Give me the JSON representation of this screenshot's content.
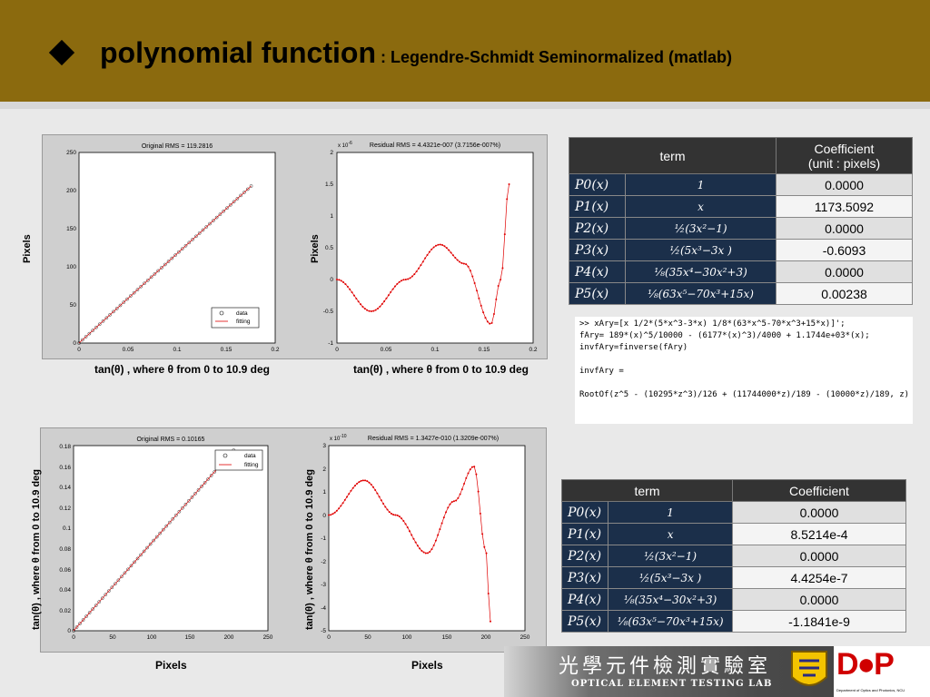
{
  "header": {
    "title_main": "polynomial function",
    "title_sub": " : Legendre-Schmidt Seminormalized (matlab)",
    "bg_color": "#8b6a0e"
  },
  "plots": {
    "p1": {
      "title": "Original RMS = 119.2816",
      "yticks": [
        "250",
        "200",
        "150",
        "100",
        "50",
        "0"
      ],
      "xticks": [
        "0",
        "0.05",
        "0.1",
        "0.15",
        "0.2"
      ],
      "legend": [
        "data",
        "fitting"
      ],
      "ylabel": "Pixels",
      "caption": "tan(θ) , where θ from 0 to 10.9 deg"
    },
    "p2": {
      "title": "Residual RMS = 4.4321e-007 (3.7156e-007%)",
      "exponent": "x 10",
      "exponent_pow": "-6",
      "yticks": [
        "2",
        "1.5",
        "1",
        "0.5",
        "0",
        "-0.5",
        "-1"
      ],
      "xticks": [
        "0",
        "0.05",
        "0.1",
        "0.15",
        "0.2"
      ],
      "ylabel": "Pixels",
      "caption": "tan(θ) , where θ from 0 to 10.9 deg"
    },
    "p3": {
      "title": "Original RMS = 0.10165",
      "yticks": [
        "0.18",
        "0.16",
        "0.14",
        "0.12",
        "0.1",
        "0.08",
        "0.06",
        "0.04",
        "0.02",
        "0"
      ],
      "xticks": [
        "0",
        "50",
        "100",
        "150",
        "200",
        "250"
      ],
      "legend": [
        "data",
        "fitting"
      ],
      "ylabel": "tan(θ) , where θ from 0 to 10.9 deg",
      "caption": "Pixels"
    },
    "p4": {
      "title": "Residual RMS = 1.3427e-010 (1.3209e-007%)",
      "exponent": "x 10",
      "exponent_pow": "-10",
      "yticks": [
        "3",
        "2",
        "1",
        "0",
        "-1",
        "-2",
        "-3",
        "-4",
        "-5"
      ],
      "xticks": [
        "0",
        "50",
        "100",
        "150",
        "200",
        "250"
      ],
      "ylabel": "tan(θ) , where θ from 0 to 10.9 deg",
      "caption": "Pixels"
    }
  },
  "table1": {
    "header_term": "term",
    "header_coef_line1": "Coefficient",
    "header_coef_line2": "(unit : pixels)",
    "rows": [
      {
        "term": "P0(x)",
        "expr": "1",
        "value": "0.0000"
      },
      {
        "term": "P1(x)",
        "expr": "x",
        "value": "1173.5092"
      },
      {
        "term": "P2(x)",
        "expr": "½(3x²−1)",
        "value": "0.0000"
      },
      {
        "term": "P3(x)",
        "expr": "½(5x³−3x  )",
        "value": "-0.6093"
      },
      {
        "term": "P4(x)",
        "expr": "⅛(35x⁴−30x²+3)",
        "value": "0.0000"
      },
      {
        "term": "P5(x)",
        "expr": "⅛(63x⁵−70x³+15x)",
        "value": "0.00238"
      }
    ]
  },
  "code": {
    "lines": [
      ">> xAry=[x 1/2*(5*x^3-3*x) 1/8*(63*x^5-70*x^3+15*x)]';",
      "fAry= 189*(x)^5/10000 - (6177*(x)^3)/4000 + 1.1744e+03*(x);",
      "invfAry=finverse(fAry)",
      "",
      "invfAry =",
      "",
      "RootOf(z^5 - (10295*z^3)/126 + (11744000*z)/189 - (10000*z)/189, z)"
    ]
  },
  "table2": {
    "header_term": "term",
    "header_coef": "Coefficient",
    "rows": [
      {
        "term": "P0(x)",
        "expr": "1",
        "value": "0.0000"
      },
      {
        "term": "P1(x)",
        "expr": "x",
        "value": "8.5214e-4"
      },
      {
        "term": "P2(x)",
        "expr": "½(3x²−1)",
        "value": "0.0000"
      },
      {
        "term": "P3(x)",
        "expr": "½(5x³−3x  )",
        "value": "4.4254e-7"
      },
      {
        "term": "P4(x)",
        "expr": "⅛(35x⁴−30x²+3)",
        "value": "0.0000"
      },
      {
        "term": "P5(x)",
        "expr": "⅛(63x⁵−70x³+15x)",
        "value": "-1.1841e-9"
      }
    ]
  },
  "footer": {
    "lab_cn": "光學元件檢測實驗室",
    "lab_en": "OPTICAL ELEMENT TESTING LAB",
    "dop": "D●P",
    "dop_sub": "Department of Optics and Photonics, NCU"
  }
}
